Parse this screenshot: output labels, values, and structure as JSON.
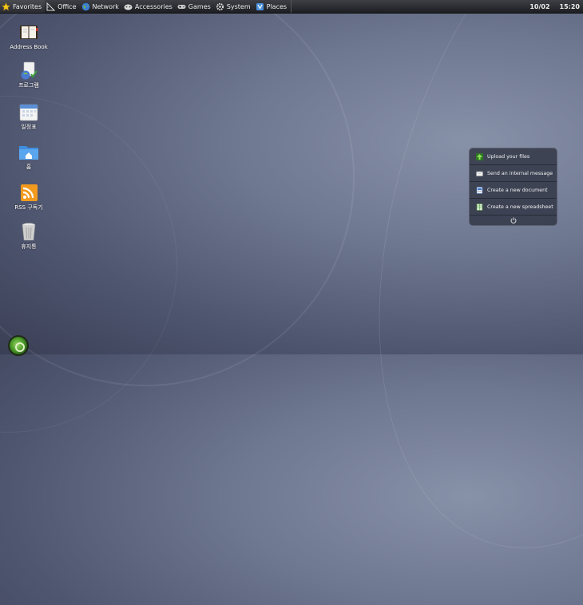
{
  "taskbar": {
    "menus": [
      {
        "label": "Favorites",
        "icon": "star-icon"
      },
      {
        "label": "Office",
        "icon": "ruler-icon"
      },
      {
        "label": "Network",
        "icon": "globe-icon"
      },
      {
        "label": "Accessories",
        "icon": "tools-icon"
      },
      {
        "label": "Games",
        "icon": "gamepad-icon"
      },
      {
        "label": "System",
        "icon": "gear-icon"
      },
      {
        "label": "Places",
        "icon": "places-icon"
      }
    ],
    "date": "10/02",
    "time": "15:20"
  },
  "desktop": {
    "icons": [
      {
        "label": "Address Book",
        "icon": "address-book-icon"
      },
      {
        "label": "프로그램",
        "icon": "programs-icon"
      },
      {
        "label": "일정표",
        "icon": "calendar-icon"
      },
      {
        "label": "홈",
        "icon": "home-folder-icon"
      },
      {
        "label": "RSS 구독기",
        "icon": "rss-icon"
      },
      {
        "label": "휴지통",
        "icon": "trash-icon"
      }
    ]
  },
  "quick_actions": {
    "items": [
      {
        "label": "Upload your files",
        "icon": "upload-icon"
      },
      {
        "label": "Send an internal message",
        "icon": "mail-icon"
      },
      {
        "label": "Create a new document",
        "icon": "document-icon"
      },
      {
        "label": "Create a new spreadsheet",
        "icon": "spreadsheet-icon"
      }
    ]
  },
  "colors": {
    "accent_green": "#4e9e2a",
    "panel_bg": "#1d1e22"
  }
}
